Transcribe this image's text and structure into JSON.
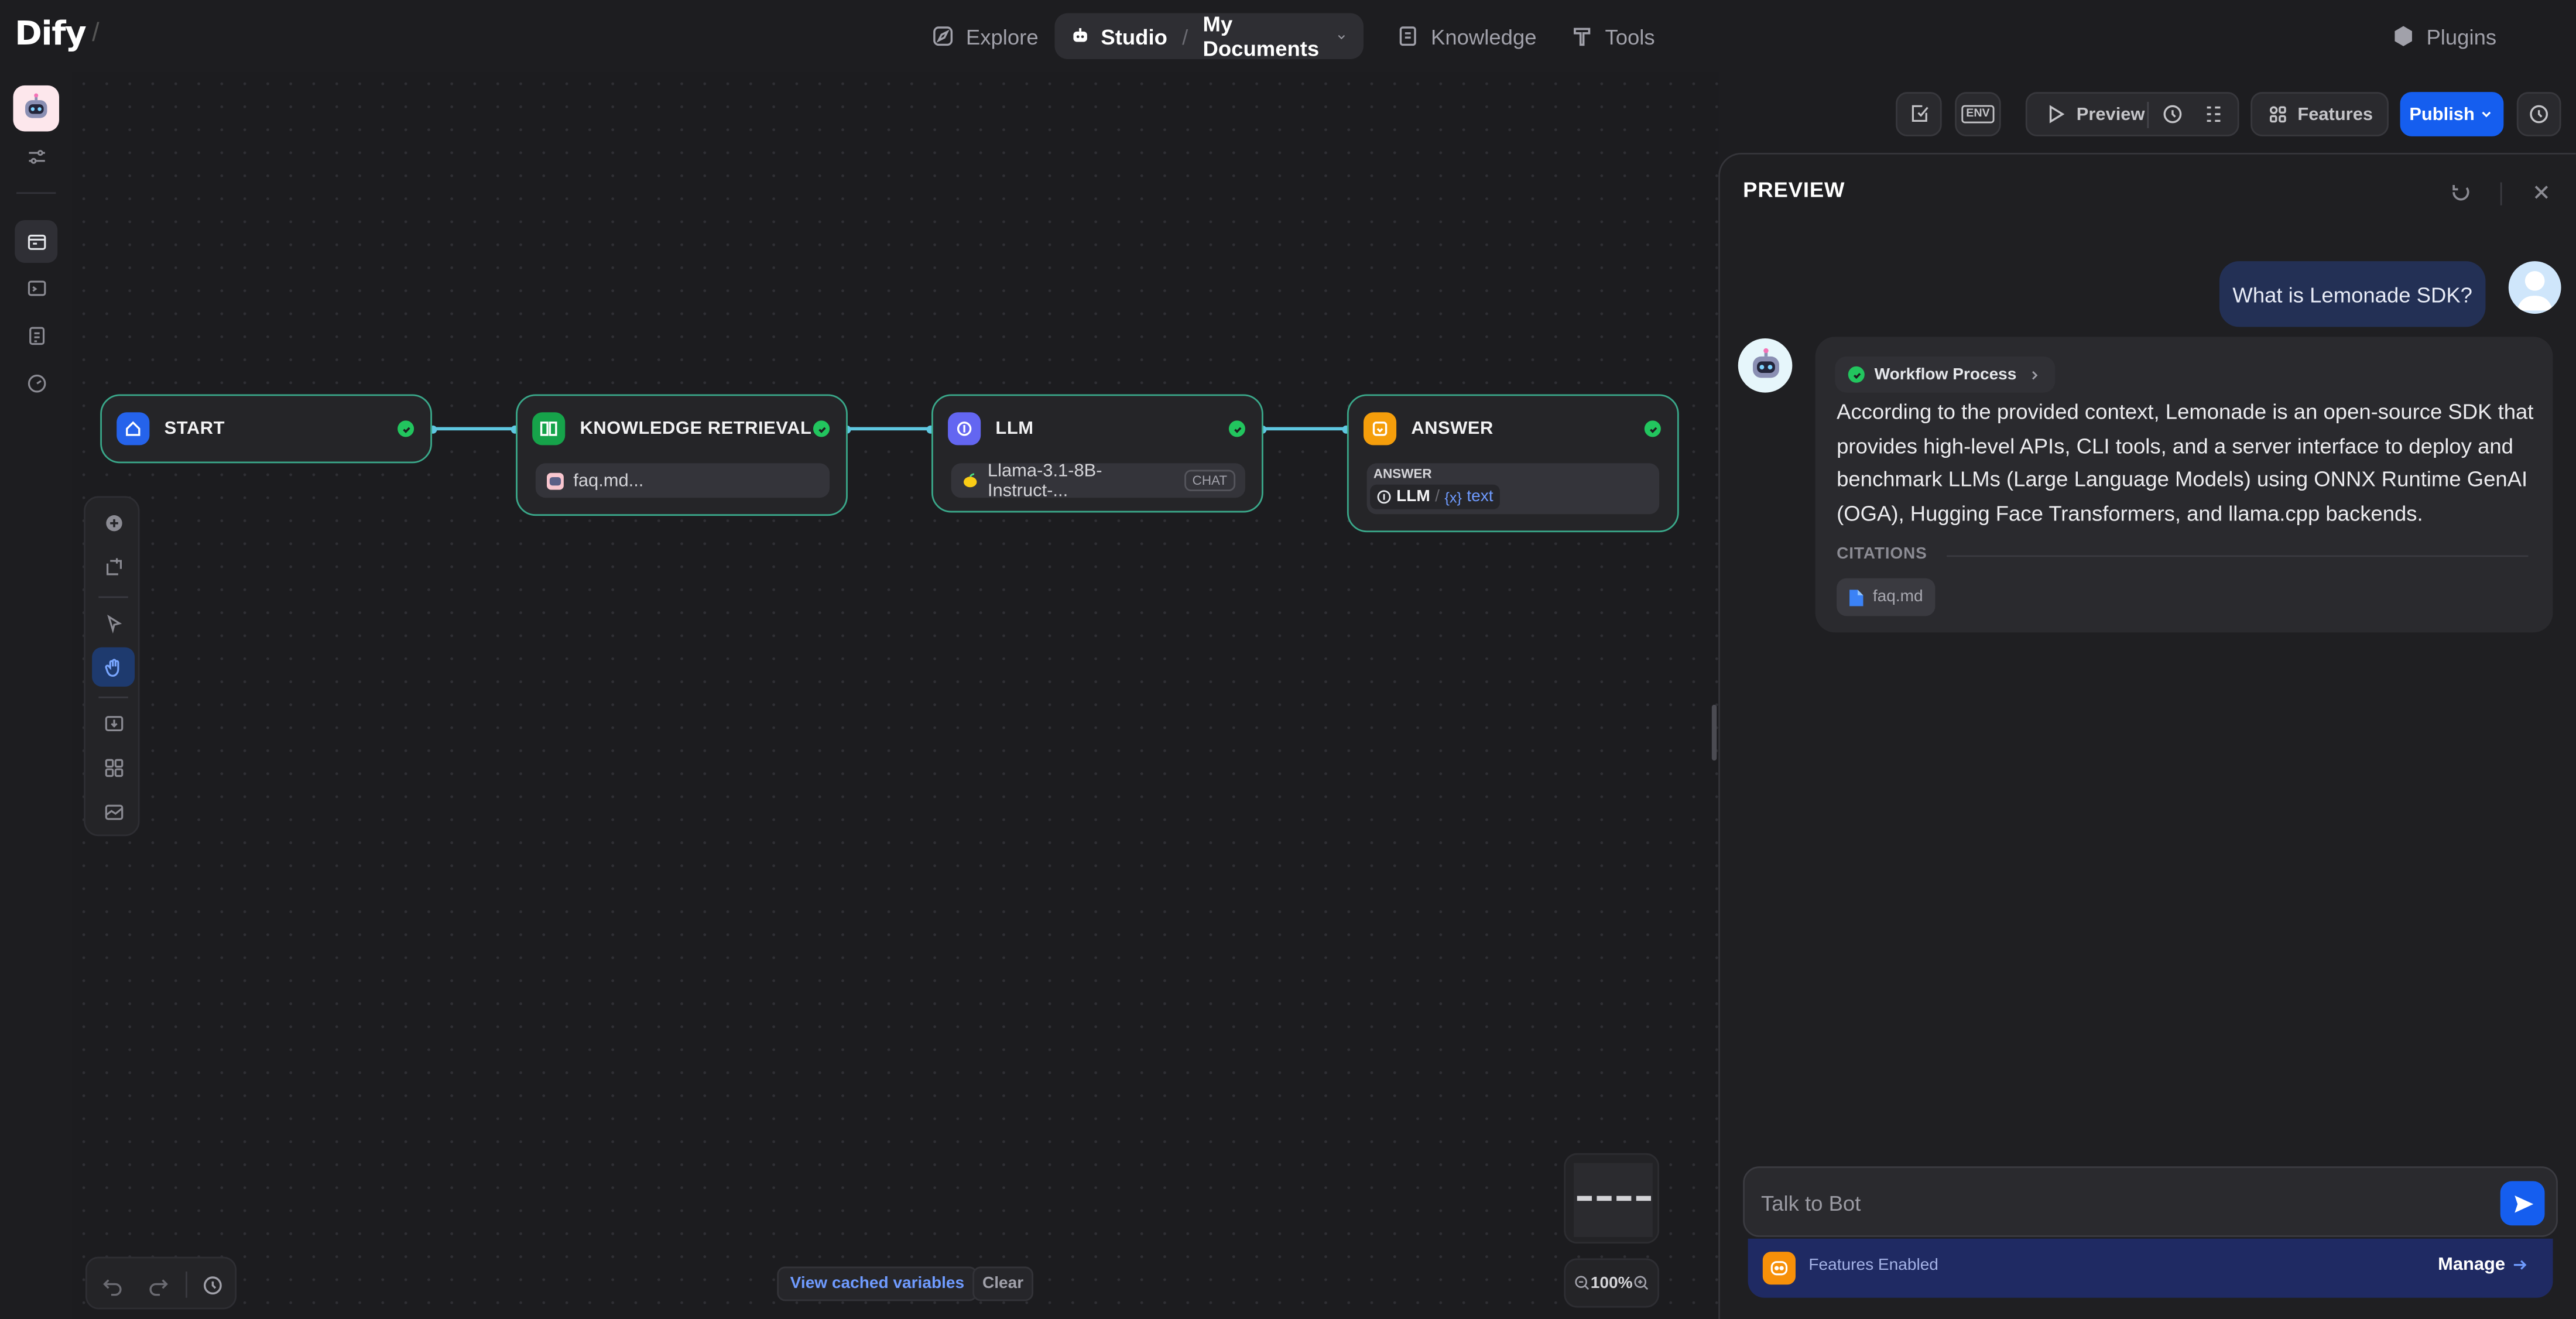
{
  "app": {
    "logo": "Dify",
    "slash": "/"
  },
  "nav": {
    "explore": "Explore",
    "studio": "Studio",
    "studio_sep": "/",
    "studio_sub": "My Documents",
    "knowledge": "Knowledge",
    "tools": "Tools",
    "plugins": "Plugins"
  },
  "toolbar": {
    "env": "ENV",
    "preview": "Preview",
    "features": "Features",
    "publish": "Publish"
  },
  "nodes": {
    "start": {
      "title": "START"
    },
    "knowledge": {
      "title": "KNOWLEDGE RETRIEVAL",
      "dataset": "faq.md..."
    },
    "llm": {
      "title": "LLM",
      "model": "Llama-3.1-8B-Instruct-...",
      "mode": "CHAT"
    },
    "answer": {
      "title": "ANSWER",
      "label": "ANSWER",
      "var_node": "LLM",
      "var_sep": "/",
      "var_prefix": "{x}",
      "var_name": "text"
    }
  },
  "canvas": {
    "view_cached": "View cached variables",
    "clear": "Clear",
    "zoom": "100%"
  },
  "preview": {
    "title": "PREVIEW",
    "user_message": "What is Lemonade SDK?",
    "workflow_process": "Workflow Process",
    "answer": "According to the provided context, Lemonade is an open-source SDK that provides high-level APIs, CLI tools, and a server interface to deploy and benchmark LLMs (Large Language Models) using ONNX Runtime GenAI (OGA), Hugging Face Transformers, and llama.cpp backends.",
    "citations_label": "CITATIONS",
    "citation": "faq.md",
    "input_placeholder": "Talk to Bot",
    "features_enabled": "Features Enabled",
    "manage": "Manage"
  },
  "colors": {
    "accent": "#155eef",
    "node_border": "#3aa88a",
    "edge": "#5fc7e0",
    "success": "#22c55e"
  }
}
